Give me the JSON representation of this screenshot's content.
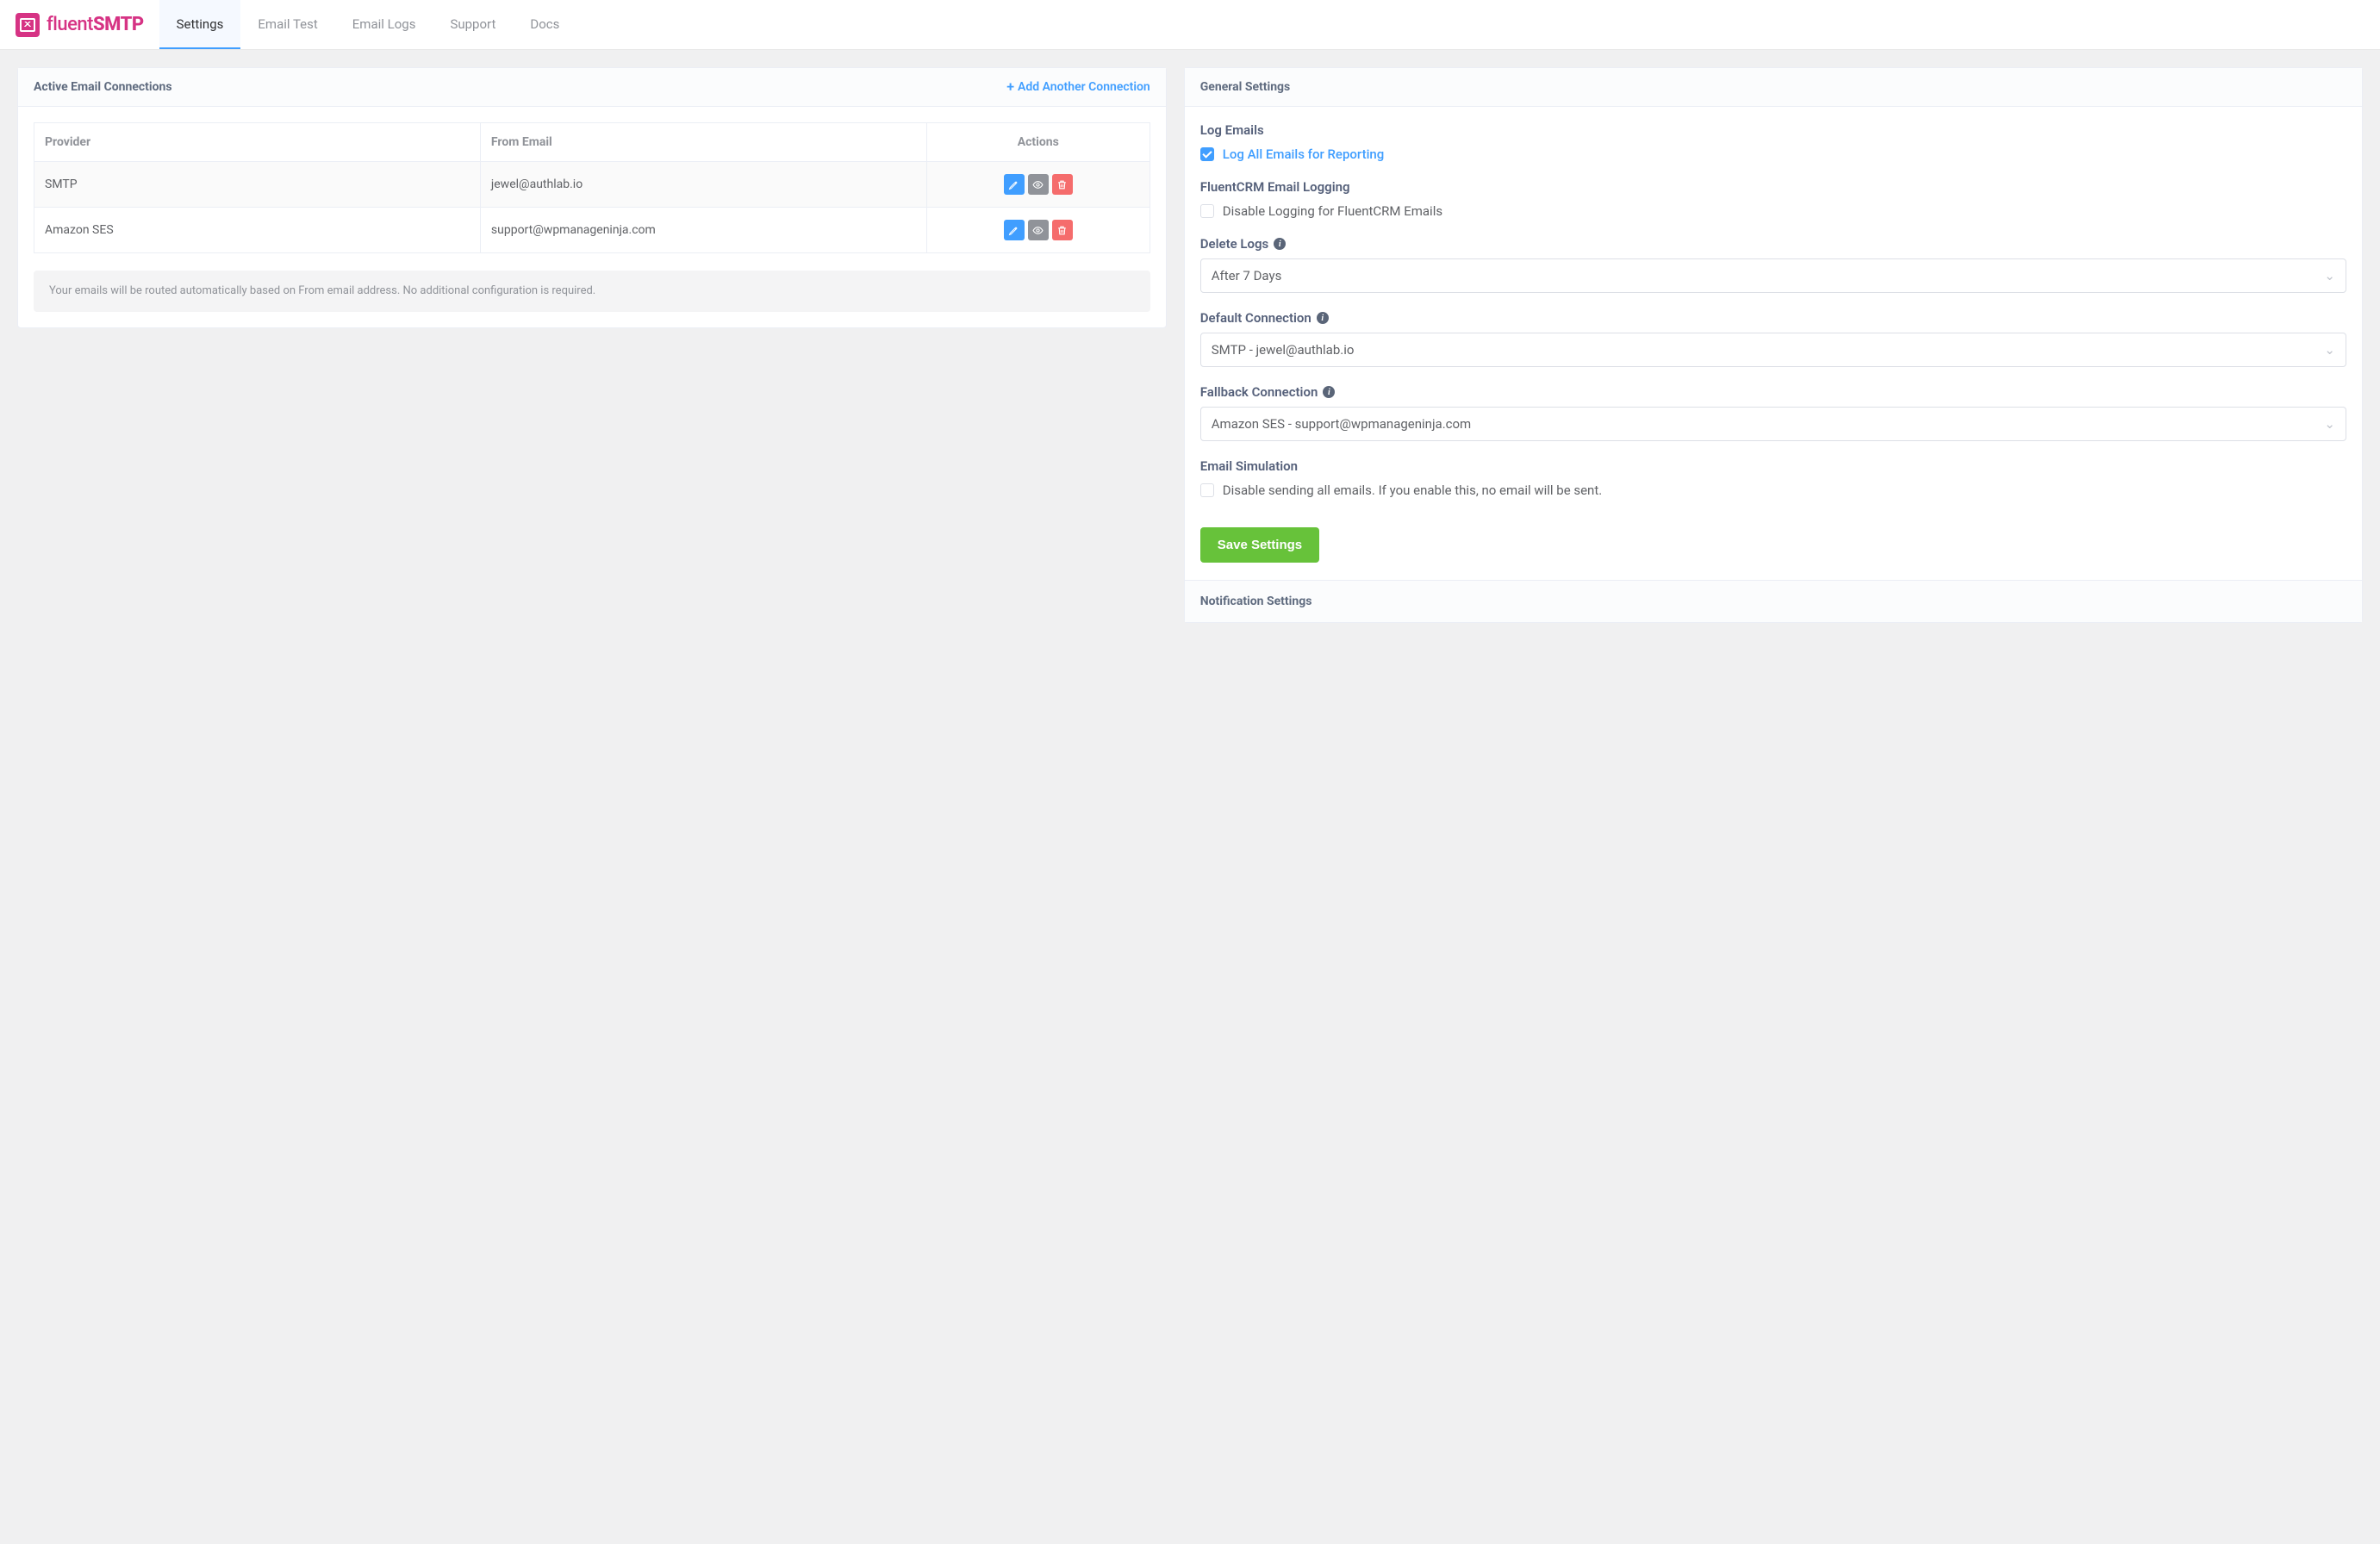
{
  "logo": {
    "prefix": "fluent",
    "suffix": "SMTP"
  },
  "tabs": [
    {
      "label": "Settings",
      "active": true
    },
    {
      "label": "Email Test"
    },
    {
      "label": "Email Logs"
    },
    {
      "label": "Support"
    },
    {
      "label": "Docs"
    }
  ],
  "left": {
    "title": "Active Email Connections",
    "add_label": "Add Another Connection",
    "headers": {
      "provider": "Provider",
      "email": "From Email",
      "actions": "Actions"
    },
    "rows": [
      {
        "provider": "SMTP",
        "email": "jewel@authlab.io"
      },
      {
        "provider": "Amazon SES",
        "email": "support@wpmanageninja.com"
      }
    ],
    "note": "Your emails will be routed automatically based on From email address. No additional configuration is required."
  },
  "right": {
    "title": "General Settings",
    "log_emails": {
      "label": "Log Emails",
      "check_label": "Log All Emails for Reporting",
      "checked": true
    },
    "crm_logging": {
      "label": "FluentCRM Email Logging",
      "check_label": "Disable Logging for FluentCRM Emails",
      "checked": false
    },
    "delete_logs": {
      "label": "Delete Logs",
      "value": "After 7 Days"
    },
    "default_conn": {
      "label": "Default Connection",
      "value": "SMTP - jewel@authlab.io"
    },
    "fallback_conn": {
      "label": "Fallback Connection",
      "value": "Amazon SES - support@wpmanageninja.com"
    },
    "simulation": {
      "label": "Email Simulation",
      "check_label": "Disable sending all emails. If you enable this, no email will be sent.",
      "checked": false
    },
    "save_label": "Save Settings",
    "notif_title": "Notification Settings"
  }
}
